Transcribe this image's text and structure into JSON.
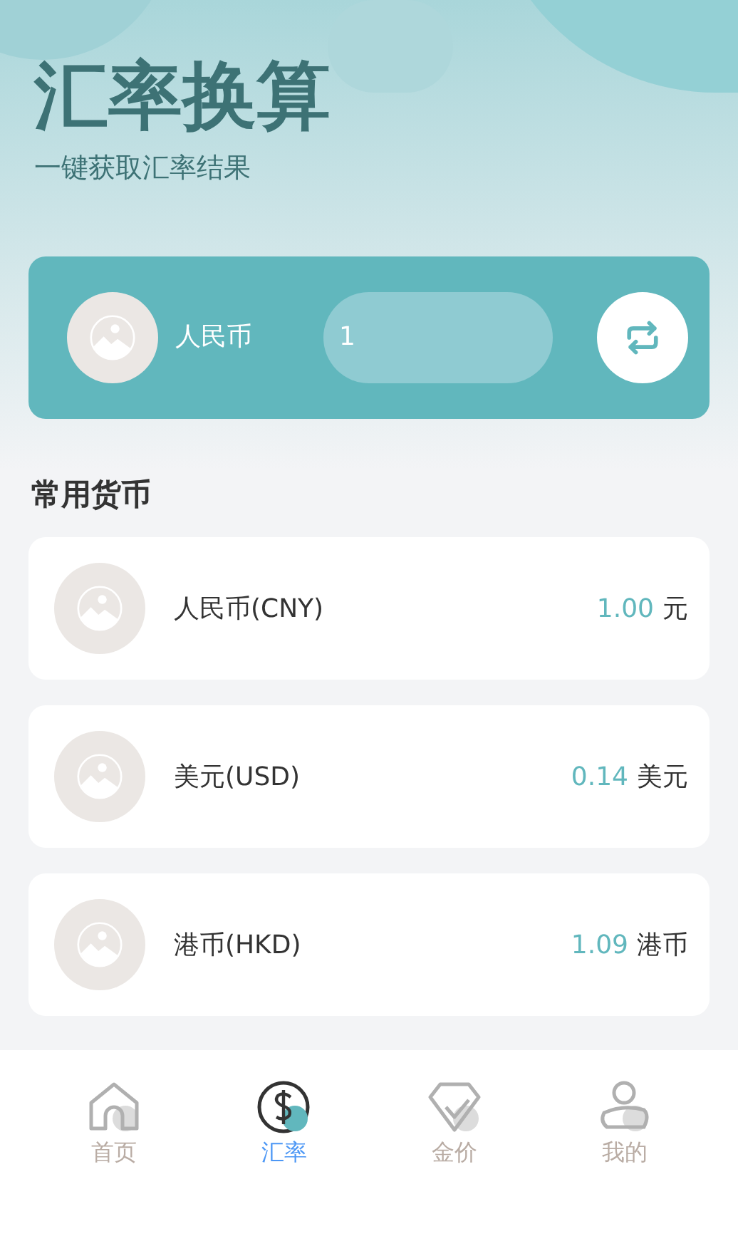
{
  "header": {
    "title": "汇率换算",
    "subtitle": "一键获取汇率结果"
  },
  "converter": {
    "currency": "人民币",
    "amount": "1"
  },
  "section_title": "常用货币",
  "currencies": [
    {
      "name": "人民币(CNY)",
      "value": "1.00",
      "unit": "元"
    },
    {
      "name": "美元(USD)",
      "value": "0.14",
      "unit": "美元"
    },
    {
      "name": "港币(HKD)",
      "value": "1.09",
      "unit": "港币"
    }
  ],
  "tabs": [
    {
      "label": "首页",
      "kind": "home",
      "selected": false
    },
    {
      "label": "汇率",
      "kind": "dollar",
      "selected": true
    },
    {
      "label": "金价",
      "kind": "diamond",
      "selected": false
    },
    {
      "label": "我的",
      "kind": "user",
      "selected": false
    }
  ]
}
